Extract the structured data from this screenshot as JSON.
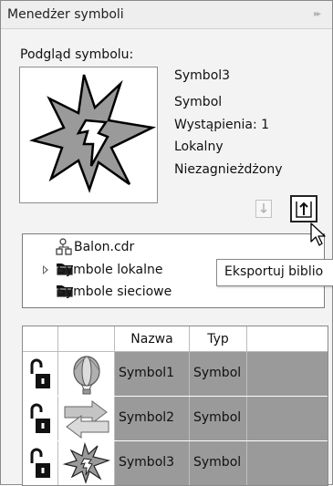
{
  "panel": {
    "title": "Menedżer symboli",
    "collapse_glyph": "▸▸"
  },
  "preview": {
    "label": "Podgląd symbolu:"
  },
  "symbol_info": {
    "name": "Symbol3",
    "kind": "Symbol",
    "instances": "Wystąpienia: 1",
    "scope": "Lokalny",
    "nesting": "Niezagnieżdżony"
  },
  "buttons": {
    "import_icon": "arrow-down-into-tray-icon",
    "export_icon": "arrow-up-out-of-tray-icon"
  },
  "tree": {
    "items": [
      {
        "label": "Balon.cdr",
        "icon": "document-tree-icon"
      },
      {
        "label": "Symbole lokalne",
        "icon": "folder-icon",
        "expandable": true
      },
      {
        "label": "Symbole sieciowe",
        "icon": "folder-icon"
      }
    ]
  },
  "tooltip": {
    "text": "Eksportuj biblio"
  },
  "table": {
    "headers": [
      "",
      "",
      "Nazwa",
      "Typ",
      ""
    ],
    "rows": [
      {
        "name": "Symbol1",
        "type": "Symbol",
        "thumb": "balloon-thumbnail"
      },
      {
        "name": "Symbol2",
        "type": "Symbol",
        "thumb": "arrows-thumbnail"
      },
      {
        "name": "Symbol3",
        "type": "Symbol",
        "thumb": "burst-thumbnail"
      }
    ]
  },
  "colors": {
    "row_selected": "#9a9a9a",
    "panel_bg": "#f3f3f3"
  }
}
